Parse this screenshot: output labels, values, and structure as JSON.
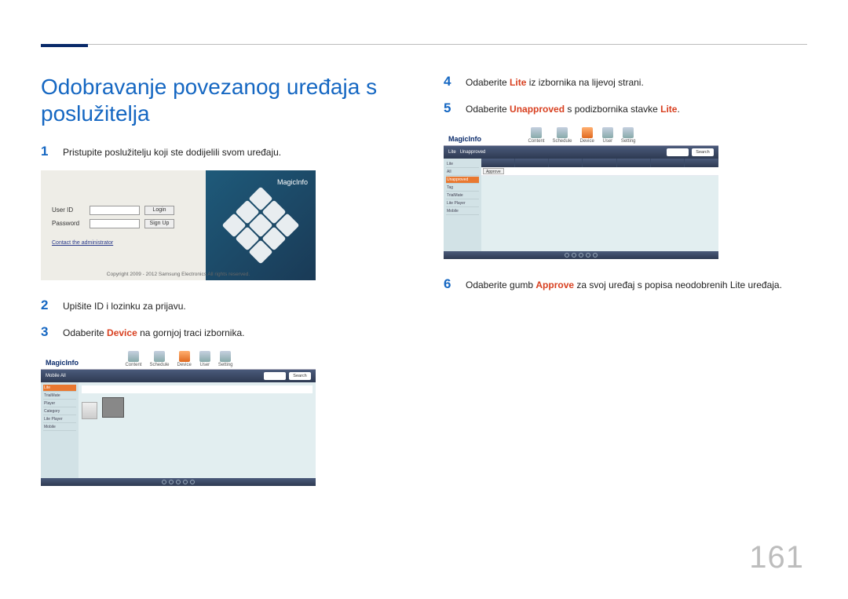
{
  "page_number": "161",
  "title": "Odobravanje povezanog uređaja s poslužitelja",
  "steps_left": [
    {
      "num": "1",
      "pre": "Pristupite poslužitelju koji ste dodijelili svom uređaju."
    },
    {
      "num": "2",
      "pre": "Upišite ID i lozinku za prijavu."
    },
    {
      "num": "3",
      "pre": "Odaberite ",
      "kw": "Device",
      "post": " na gornjoj traci izbornika."
    }
  ],
  "steps_right": [
    {
      "num": "4",
      "pre": "Odaberite ",
      "kw": "Lite",
      "post": " iz izbornika na lijevoj strani."
    },
    {
      "num": "5",
      "pre": "Odaberite ",
      "kw": "Unapproved",
      "post": " s podizbornika stavke ",
      "kw2": "Lite",
      "post2": "."
    },
    {
      "num": "6",
      "pre": "Odaberite gumb ",
      "kw": "Approve",
      "post": " za svoj uređaj s popisa neodobrenih Lite uređaja."
    }
  ],
  "login": {
    "brand": "MagicInfo",
    "user_label": "User ID",
    "pass_label": "Password",
    "login_btn": "Login",
    "signup_btn": "Sign Up",
    "contact": "Contact the administrator",
    "copyright": "Copyright 2009 - 2012 Samsung Electronics All rights reserved."
  },
  "mi": {
    "logo": "MagicInfo",
    "tabs": [
      "Content",
      "Schedule",
      "Device",
      "User",
      "Setting"
    ],
    "crumb": "Mobile   All",
    "side": [
      "Lite",
      "TrialMate",
      "Player",
      "Category",
      "Lite Player",
      "Mobile"
    ],
    "search": "Search"
  },
  "mi2": {
    "side": [
      "Lite",
      "All",
      "Unapproved",
      "Tag",
      "TrialMate",
      "Lite Player",
      "Mobile"
    ]
  }
}
